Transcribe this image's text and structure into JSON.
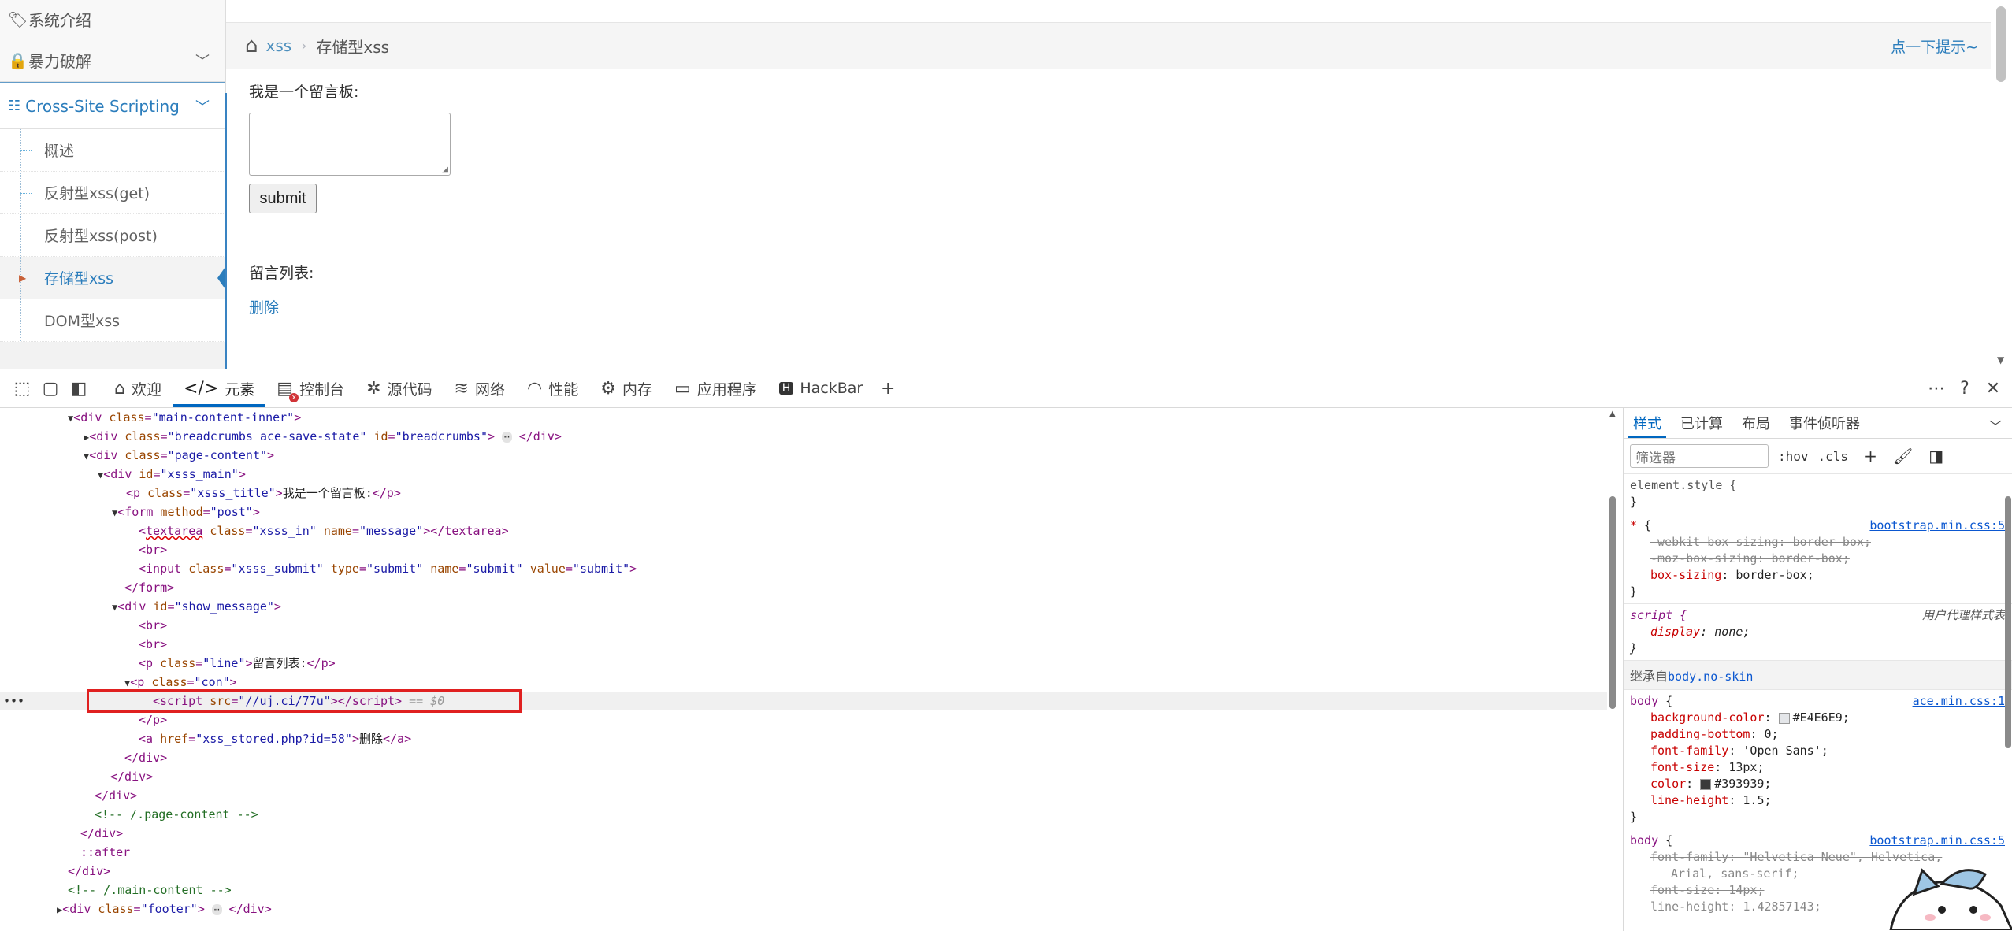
{
  "sidebar": {
    "system_intro": "系统介绍",
    "brute_force": "暴力破解",
    "xss_section": "Cross-Site Scripting",
    "items": [
      {
        "label": "概述"
      },
      {
        "label": "反射型xss(get)"
      },
      {
        "label": "反射型xss(post)"
      },
      {
        "label": "存储型xss"
      },
      {
        "label": "DOM型xss"
      }
    ]
  },
  "breadcrumbs": {
    "link": "xss",
    "current": "存储型xss",
    "hint": "点一下提示~"
  },
  "main": {
    "msg_title": "我是一个留言板:",
    "submit_label": "submit",
    "list_title": "留言列表:",
    "delete_label": "删除"
  },
  "devtools": {
    "tabs": [
      {
        "label": "欢迎",
        "icon": "home-icon"
      },
      {
        "label": "元素",
        "icon": "code-icon"
      },
      {
        "label": "控制台",
        "icon": "console-icon"
      },
      {
        "label": "源代码",
        "icon": "bug-icon"
      },
      {
        "label": "网络",
        "icon": "wifi-icon"
      },
      {
        "label": "性能",
        "icon": "gauge-icon"
      },
      {
        "label": "内存",
        "icon": "gear-icon"
      },
      {
        "label": "应用程序",
        "icon": "app-icon"
      },
      {
        "label": "HackBar",
        "icon": "hackbar-icon"
      }
    ],
    "console_errors": "x",
    "elements": {
      "l1_class": "main-content-inner",
      "l2_class": "breadcrumbs ace-save-state",
      "l2_id": "breadcrumbs",
      "l3_class": "page-content",
      "l4_id": "xsss_main",
      "l5_class": "xsss_title",
      "l5_text": "我是一个留言板:",
      "l6_method": "post",
      "l7_class": "xsss_in",
      "l7_name": "message",
      "l9_class": "xsss_submit",
      "l9_type": "submit",
      "l9_name": "submit",
      "l9_value": "submit",
      "l11_id": "show_message",
      "l14_class": "line",
      "l14_text": "留言列表:",
      "l15_class": "con",
      "l16_src": "//uj.ci/77u",
      "l16_eq": "== $0",
      "l18_href": "xss_stored.php?id=58",
      "l18_text": "删除",
      "c1": "<!-- /.page-content -->",
      "after": "::after",
      "c2": "<!-- /.main-content -->",
      "l25_class": "footer"
    },
    "styles": {
      "tabs": [
        "样式",
        "已计算",
        "布局",
        "事件侦听器"
      ],
      "filter_placeholder": "筛选器",
      "hov": ":hov",
      "cls": ".cls",
      "element_style": "element.style {",
      "r1_src": "bootstrap.min.css:5",
      "r1_p1": "-webkit-box-sizing: border-box;",
      "r1_p2": "-moz-box-sizing: border-box;",
      "r1_p3n": "box-sizing",
      "r1_p3v": "border-box;",
      "r2_sel": "script {",
      "r2_ua": "用户代理样式表",
      "r2_p1n": "display",
      "r2_p1v": "none;",
      "inherit_label": "继承自",
      "inherit_sel": "body.no-skin",
      "r3_src": "ace.min.css:1",
      "r3_p1n": "background-color",
      "r3_p1v": "#E4E6E9;",
      "r3_p2n": "padding-bottom",
      "r3_p2v": "0;",
      "r3_p3n": "font-family",
      "r3_p3v": "'Open Sans';",
      "r3_p4n": "font-size",
      "r3_p4v": "13px;",
      "r3_p5n": "color",
      "r3_p5v": "#393939;",
      "r3_p6n": "line-height",
      "r3_p6v": "1.5;",
      "r4_src": "bootstrap.min.css:5",
      "r4_p1": "font-family: \"Helvetica Neue\", Helvetica,",
      "r4_p1b": "Arial, sans-serif;",
      "r4_p2": "font-size: 14px;",
      "r4_p3": "line-height: 1.42857143;"
    }
  }
}
